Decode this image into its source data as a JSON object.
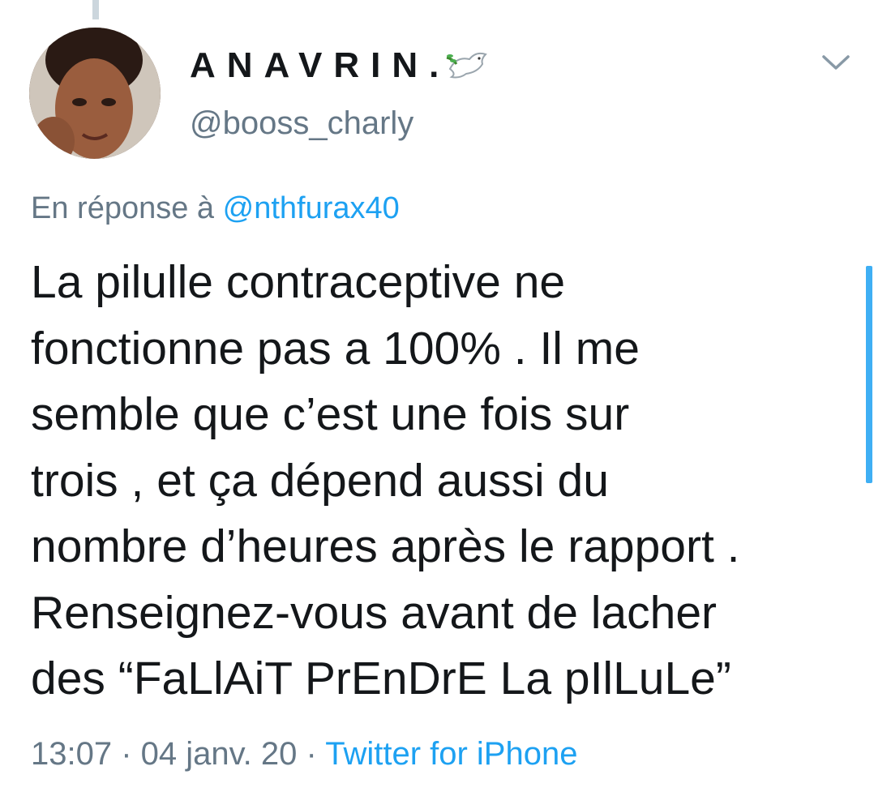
{
  "author": {
    "display_name": "ANAVRIN.",
    "handle": "@booss_charly",
    "name_emoji": "dove-icon"
  },
  "reply": {
    "prefix": "En réponse à",
    "to": "@nthfurax40"
  },
  "tweet": {
    "lines": [
      "La pilulle contraceptive ne",
      "fonctionne pas a 100% . Il me",
      "semble que c’est une fois sur",
      "trois , et ça dépend aussi du",
      "nombre d’heures après le rapport .",
      "Renseignez-vous avant de lacher",
      "des “FaLlAiT PrEnDrE La pIlLuLe”"
    ]
  },
  "meta": {
    "time": "13:07",
    "sep1": " · ",
    "date": "04 janv. 20",
    "sep2": " · ",
    "source": "Twitter for iPhone"
  },
  "colors": {
    "link": "#1da1f2",
    "muted": "#657786",
    "text": "#14171a"
  }
}
